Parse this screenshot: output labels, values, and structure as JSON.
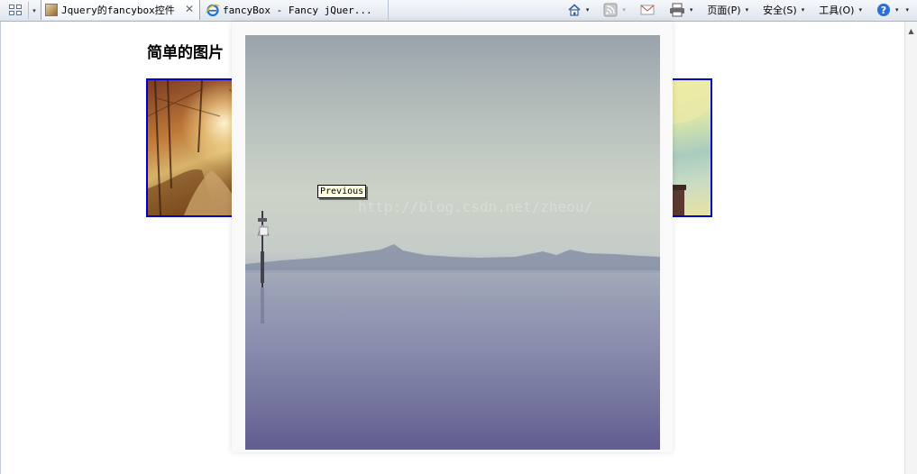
{
  "browser": {
    "tabs": [
      {
        "title": "Jquery的fancybox控件",
        "close_glyph": "✕"
      },
      {
        "title": "fancyBox - Fancy jQuer..."
      }
    ],
    "tablist_glyph": "▾",
    "commands": {
      "home_dd": "▾",
      "feeds_dd": "▾",
      "print_dd": "▾",
      "page": "页面(P)",
      "safety": "安全(S)",
      "tools": "工具(O)",
      "help_dd": "▾",
      "menu_dd": "▾"
    }
  },
  "page": {
    "heading": "简单的图片"
  },
  "lightbox": {
    "watermark": "http://blog.csdn.net/zheou/",
    "tooltip": "Previous"
  },
  "scrollbar": {
    "up_glyph": "▲"
  }
}
